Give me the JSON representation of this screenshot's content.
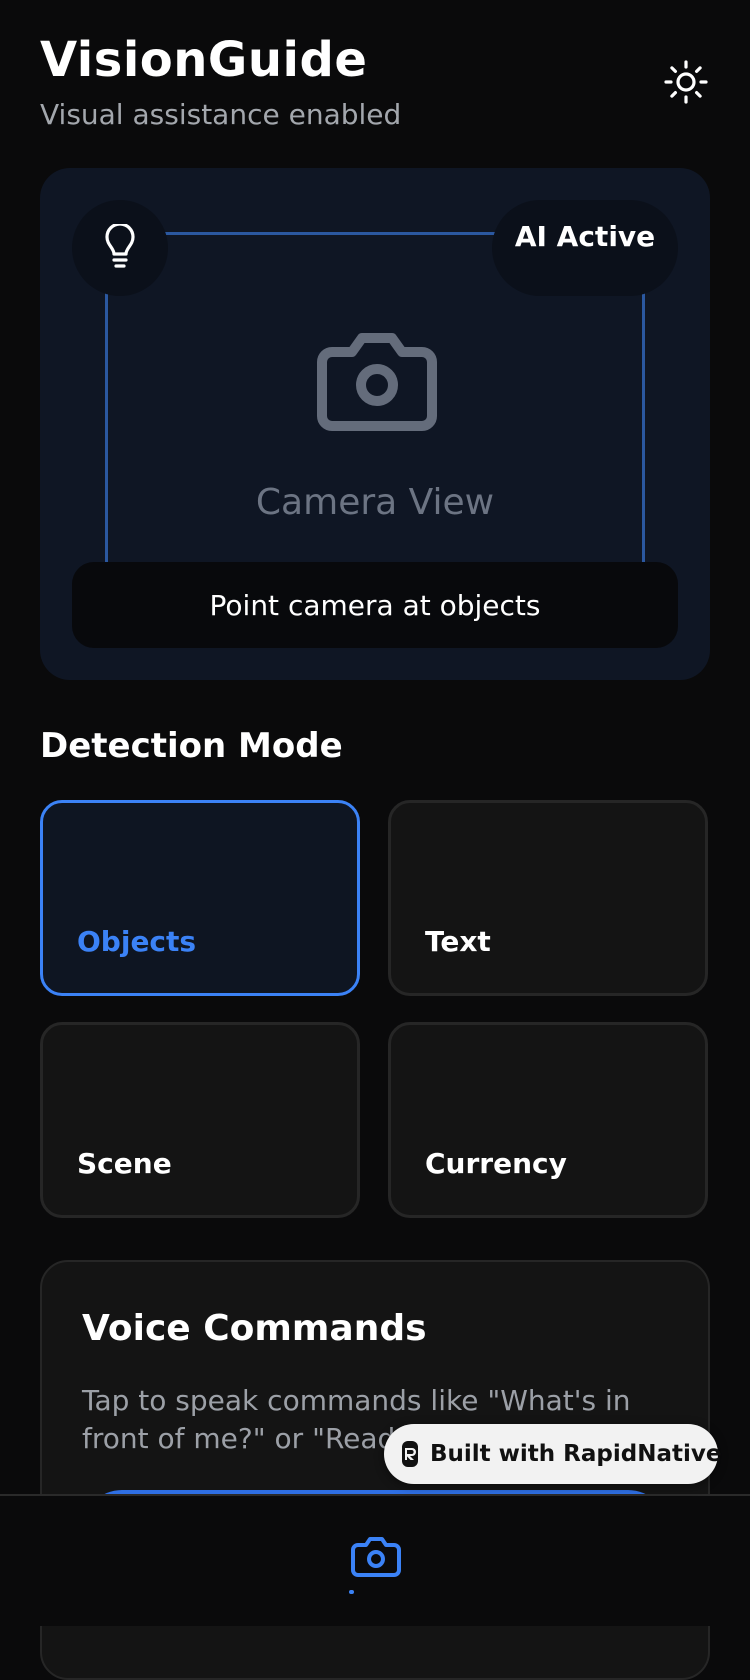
{
  "header": {
    "title": "VisionGuide",
    "subtitle": "Visual assistance enabled"
  },
  "camera": {
    "status_label": "AI Active",
    "placeholder_label": "Camera View",
    "hint": "Point camera at objects"
  },
  "detection": {
    "section_title": "Detection Mode",
    "modes": [
      {
        "label": "Objects",
        "active": true
      },
      {
        "label": "Text",
        "active": false
      },
      {
        "label": "Scene",
        "active": false
      },
      {
        "label": "Currency",
        "active": false
      }
    ]
  },
  "voice": {
    "title": "Voice Commands",
    "description": "Tap to speak commands like \"What's in front of me?\" or \"Read the text\""
  },
  "badge": {
    "text": "Built with RapidNative"
  },
  "colors": {
    "accent": "#3b82f6",
    "background": "#0a0a0b",
    "card": "#141414",
    "camera_card": "#0f1624"
  },
  "icons": {
    "theme": "sun-icon",
    "flash": "lightbulb-icon",
    "camera": "camera-icon",
    "nav": "camera-icon"
  }
}
